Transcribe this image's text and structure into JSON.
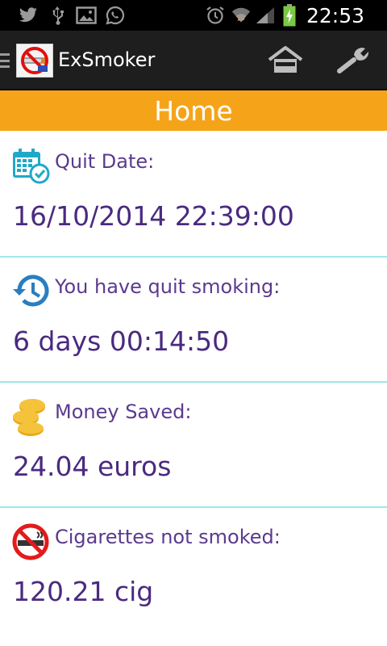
{
  "status_bar": {
    "time": "22:53",
    "left_icons": [
      "twitter-icon",
      "usb-icon",
      "image-icon",
      "whatsapp-icon"
    ],
    "right_icons": [
      "alarm-icon",
      "wifi-icon",
      "signal-icon",
      "battery-charging-icon"
    ]
  },
  "action_bar": {
    "app_title": "ExSmoker",
    "buttons": [
      "home-icon",
      "wrench-icon"
    ],
    "background": "#1e1e1e"
  },
  "page": {
    "title": "Home",
    "accent_color": "#f5a41a",
    "text_color": "#5b3a8e",
    "divider_color": "#9ee8ea"
  },
  "cards": [
    {
      "label": "Quit Date:",
      "value": "16/10/2014 22:39:00",
      "icon": "calendar-check-icon"
    },
    {
      "label": "You have quit smoking:",
      "value": "6 days 00:14:50",
      "icon": "history-icon"
    },
    {
      "label": "Money Saved:",
      "value": "24.04 euros",
      "icon": "coins-icon"
    },
    {
      "label": "Cigarettes not smoked:",
      "value": "120.21 cig",
      "icon": "no-smoking-icon"
    }
  ]
}
